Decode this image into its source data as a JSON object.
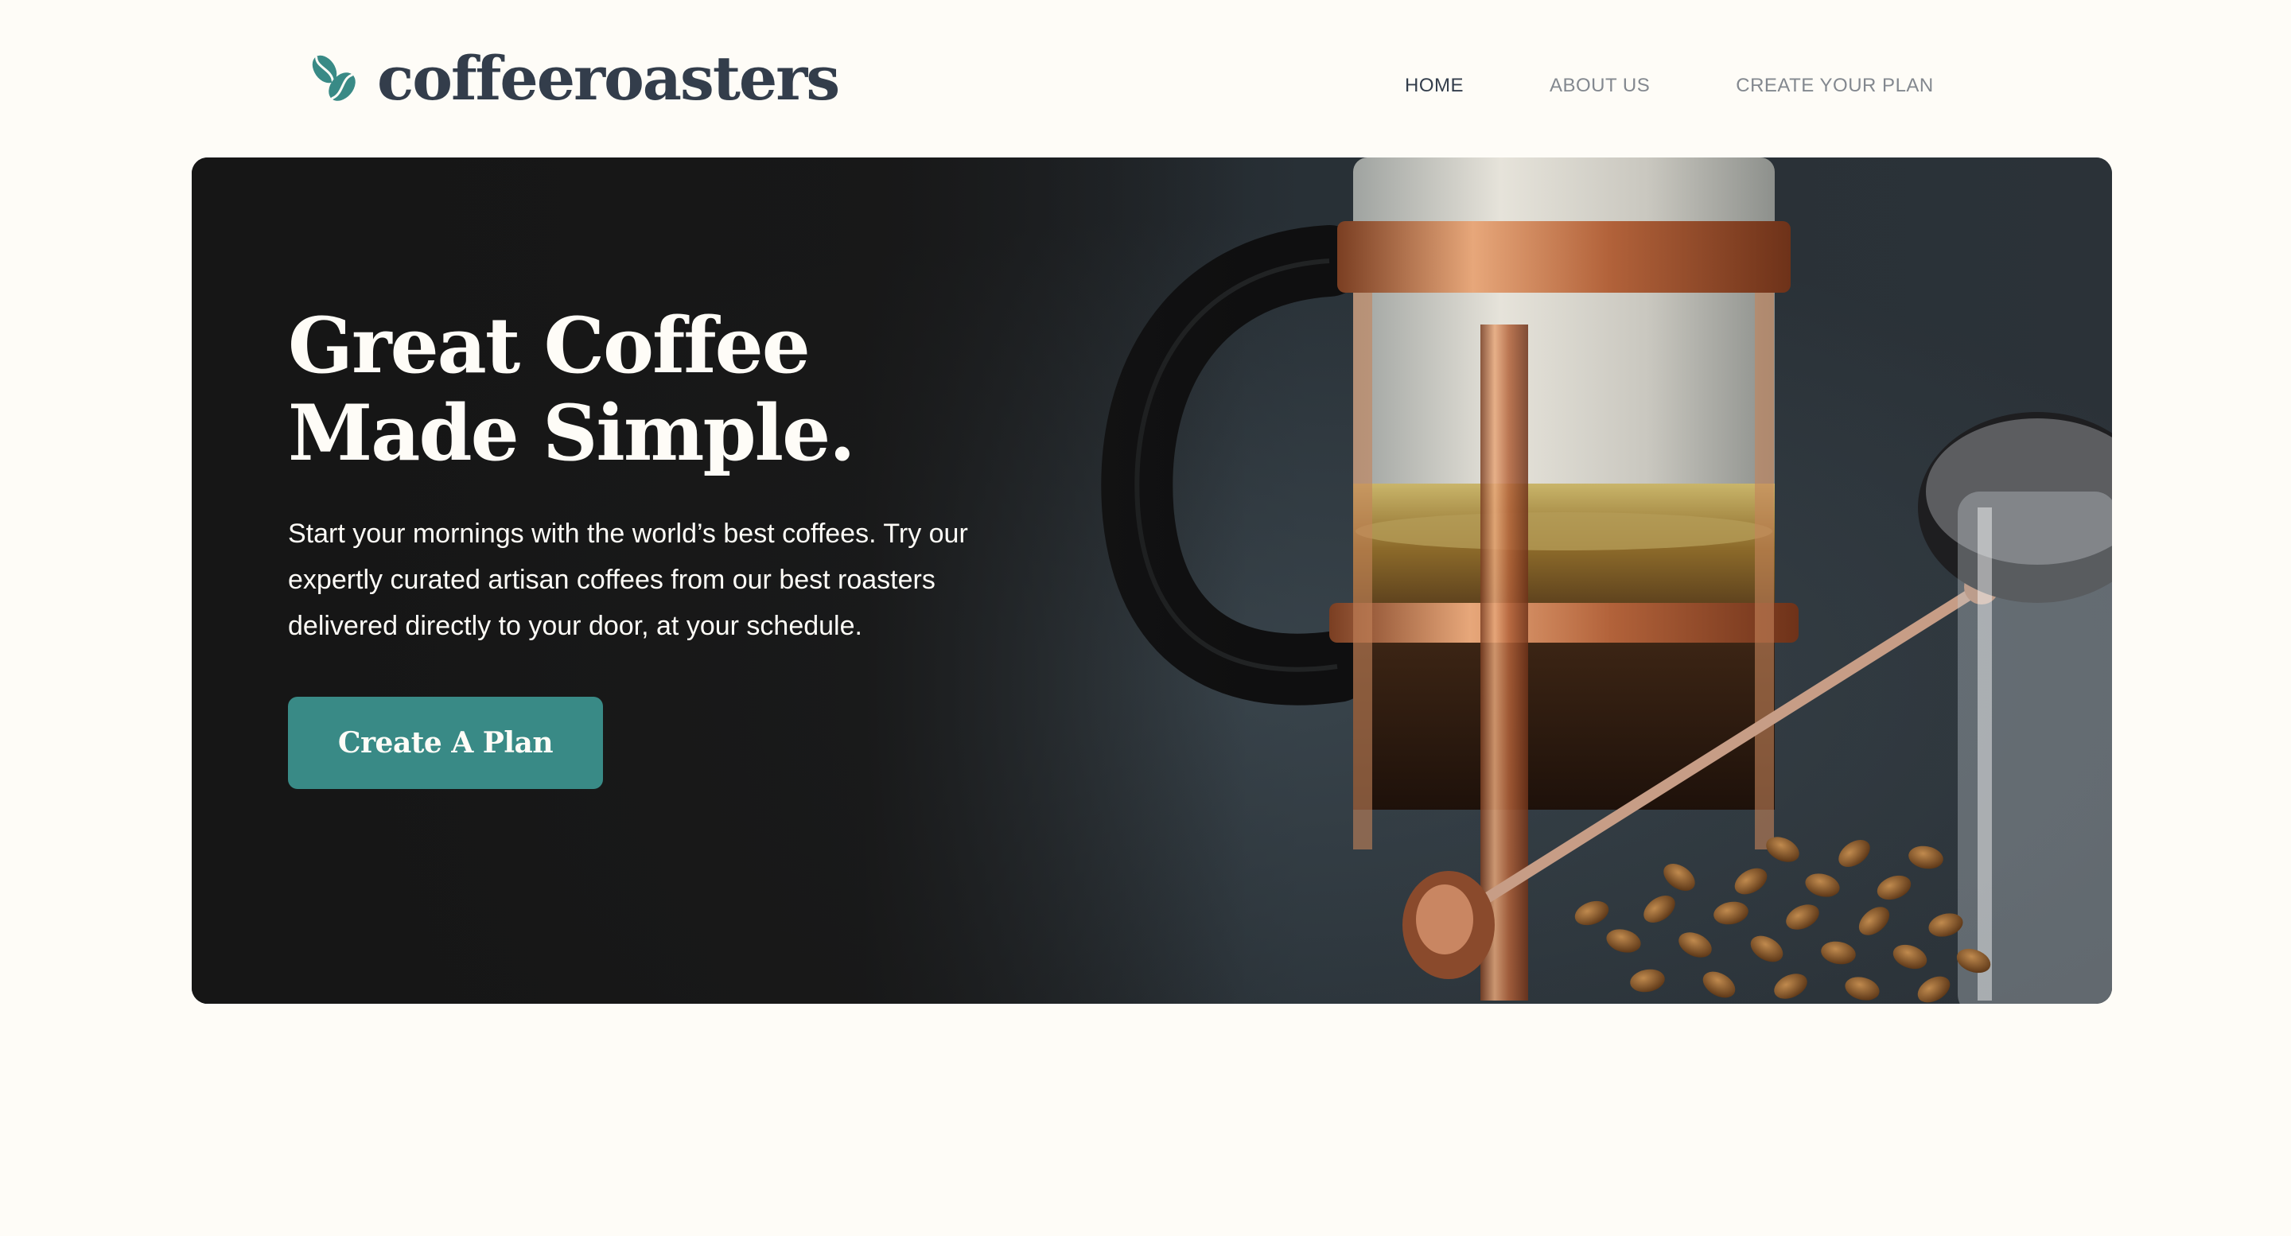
{
  "brand": {
    "name": "coffeeroasters",
    "icon": "coffee-bean-icon"
  },
  "nav": {
    "items": [
      {
        "label": "HOME",
        "active": true
      },
      {
        "label": "ABOUT US",
        "active": false
      },
      {
        "label": "CREATE YOUR PLAN",
        "active": false
      }
    ]
  },
  "hero": {
    "title_line_1": "Great Coffee",
    "title_line_2": "Made Simple.",
    "description": "Start your mornings with the world’s best coffees. Try our expertly curated artisan coffees from our best roasters delivered directly to your door, at your schedule.",
    "cta_label": "Create A Plan",
    "image": "french-press-with-coffee-beans-photo"
  },
  "colors": {
    "page_background": "#FEFCF7",
    "dark_text": "#333D4B",
    "nav_muted": "#83888F",
    "brand_accent": "#398A86",
    "hero_background": "#1A1A1A",
    "light_text": "#FEFCF7"
  }
}
